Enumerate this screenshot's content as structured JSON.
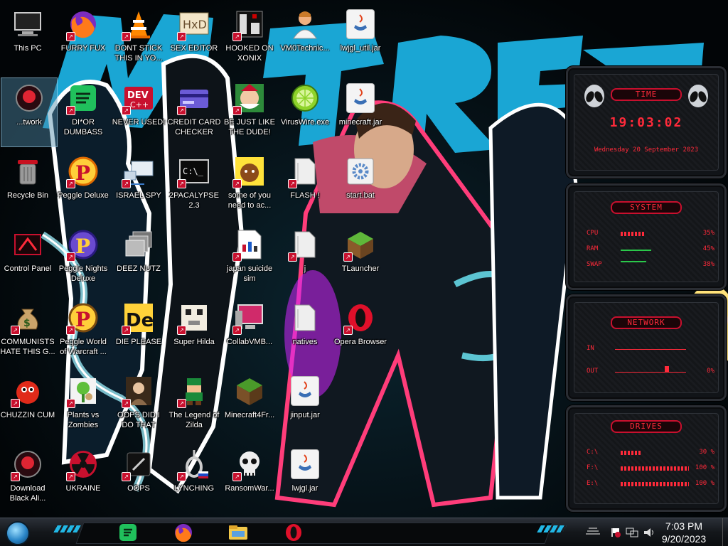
{
  "desktop": {
    "icons": [
      {
        "label": "This PC"
      },
      {
        "label": "FURRY FUX"
      },
      {
        "label": "DONT STICK THIS IN YO..."
      },
      {
        "label": "SEX EDITOR"
      },
      {
        "label": "HOOKED ON XONIX"
      },
      {
        "label": "VM0Technic..."
      },
      {
        "label": "lwjgl_util.jar"
      },
      {
        "label": "...twork"
      },
      {
        "label": "DI*OR DUMBASS"
      },
      {
        "label": "NEVER USED!"
      },
      {
        "label": "CREDIT CARD CHECKER"
      },
      {
        "label": "BE JUST LIKE THE DUDE!"
      },
      {
        "label": "VirusWire.exe"
      },
      {
        "label": "minecraft.jar"
      },
      {
        "label": "Recycle Bin"
      },
      {
        "label": "Peggle Deluxe"
      },
      {
        "label": "ISRAEL SPY"
      },
      {
        "label": "2PACALYPSE 2.3"
      },
      {
        "label": "some of you need to ac..."
      },
      {
        "label": "FLASH !"
      },
      {
        "label": "start.bat"
      },
      {
        "label": "Control Panel"
      },
      {
        "label": "Peggle Nights Deluxe"
      },
      {
        "label": "DEEZ NUTZ"
      },
      {
        "label": "japan suicide sim"
      },
      {
        "label": "j"
      },
      {
        "label": "TLauncher"
      },
      {
        "label": "COMMUNISTS HATE THIS G..."
      },
      {
        "label": "Peggle World of Warcraft ..."
      },
      {
        "label": "DIE PLEASE"
      },
      {
        "label": "Super Hilda"
      },
      {
        "label": "CollabVMB..."
      },
      {
        "label": "natives"
      },
      {
        "label": "Opera Browser"
      },
      {
        "label": "CHUZZIN CUM"
      },
      {
        "label": "Plants vs Zombies"
      },
      {
        "label": "OOPS DID I DO THAT"
      },
      {
        "label": "The Legend of Zilda"
      },
      {
        "label": "Minecraft4Fr..."
      },
      {
        "label": "jinput.jar"
      },
      {
        "label": "Download Black Ali..."
      },
      {
        "label": "UKRAINE"
      },
      {
        "label": "OOPS"
      },
      {
        "label": "LYNCHING"
      },
      {
        "label": "RansomWar..."
      },
      {
        "label": "lwjgl.jar"
      }
    ]
  },
  "widgets": {
    "time": {
      "title": "TIME",
      "clock": "19:03:02",
      "date": "Wednesday 20 September 2023"
    },
    "system": {
      "title": "SYSTEM",
      "rows": [
        {
          "key": "CPU",
          "value": "35%",
          "level": 0.35
        },
        {
          "key": "RAM",
          "value": "45%",
          "level": 0.45
        },
        {
          "key": "SWAP",
          "value": "38%",
          "level": 0.38
        }
      ]
    },
    "network": {
      "title": "NETWORK",
      "rows": [
        {
          "key": "IN",
          "value": ""
        },
        {
          "key": "OUT",
          "value": "0%"
        }
      ]
    },
    "drives": {
      "title": "DRIVES",
      "rows": [
        {
          "key": "C:\\",
          "value": "30 %",
          "level": 0.3
        },
        {
          "key": "F:\\",
          "value": "100 %",
          "level": 1.0
        },
        {
          "key": "E:\\",
          "value": "100 %",
          "level": 1.0
        }
      ]
    }
  },
  "taskbar": {
    "pinned": [
      "spotify-icon",
      "firefox-icon",
      "file-explorer-icon",
      "opera-icon"
    ],
    "clock": {
      "time": "7:03 PM",
      "date": "9/20/2023"
    }
  },
  "colors": {
    "accent": "#ff2a3a",
    "cyan": "#22b8e6"
  }
}
